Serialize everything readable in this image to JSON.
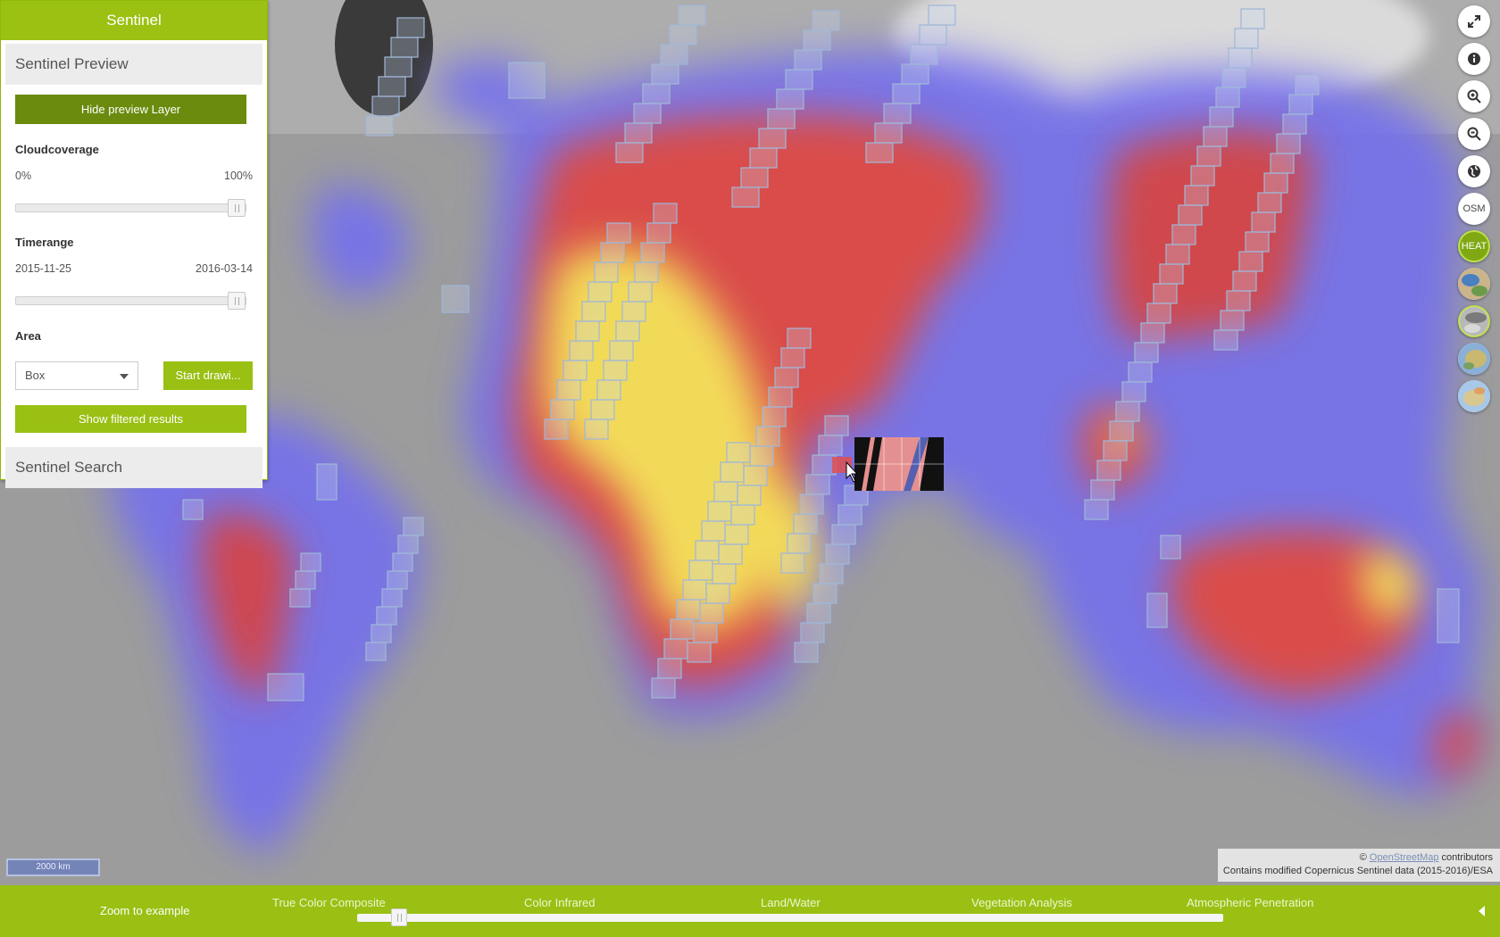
{
  "panel": {
    "title": "Sentinel",
    "preview_section": "Sentinel Preview",
    "hide_preview_label": "Hide preview Layer",
    "cloud": {
      "label": "Cloudcoverage",
      "min": "0%",
      "max": "100%",
      "value_fraction": 1.0
    },
    "time": {
      "label": "Timerange",
      "start": "2015-11-25",
      "end": "2016-03-14",
      "value_fraction": 1.0
    },
    "area": {
      "label": "Area",
      "selected": "Box",
      "draw_label": "Start drawi..."
    },
    "filter_label": "Show filtered results",
    "search_section": "Sentinel Search"
  },
  "controls": [
    {
      "name": "fullscreen-icon",
      "label": ""
    },
    {
      "name": "info-icon",
      "label": ""
    },
    {
      "name": "zoom-in-icon",
      "label": ""
    },
    {
      "name": "zoom-out-icon",
      "label": ""
    },
    {
      "name": "globe-icon",
      "label": ""
    },
    {
      "name": "osm-layer",
      "label": "OSM"
    },
    {
      "name": "heat-layer",
      "label": "HEAT",
      "active": true
    },
    {
      "name": "layer-thumb-1",
      "label": ""
    },
    {
      "name": "layer-thumb-2",
      "label": ""
    },
    {
      "name": "layer-thumb-3",
      "label": ""
    },
    {
      "name": "layer-thumb-4",
      "label": ""
    }
  ],
  "map": {
    "scale_label": "2000 km",
    "attribution": {
      "prefix": "©",
      "link": "OpenStreetMap",
      "suffix": "contributors",
      "line2": "Contains modified Copernicus Sentinel data (2015-2016)/ESA"
    }
  },
  "bottom_bar": {
    "zoom_example": "Zoom to example",
    "bands": [
      "True Color Composite",
      "Color Infrared",
      "Land/Water",
      "Vegetation Analysis",
      "Atmospheric Penetration"
    ],
    "band_slider_fraction": 0.04
  },
  "colors": {
    "accent": "#99c013",
    "accent_dark": "#6a8b0e",
    "heat_low": "#6f6cf0",
    "heat_mid": "#e8463c",
    "heat_high": "#f7ec5a"
  }
}
